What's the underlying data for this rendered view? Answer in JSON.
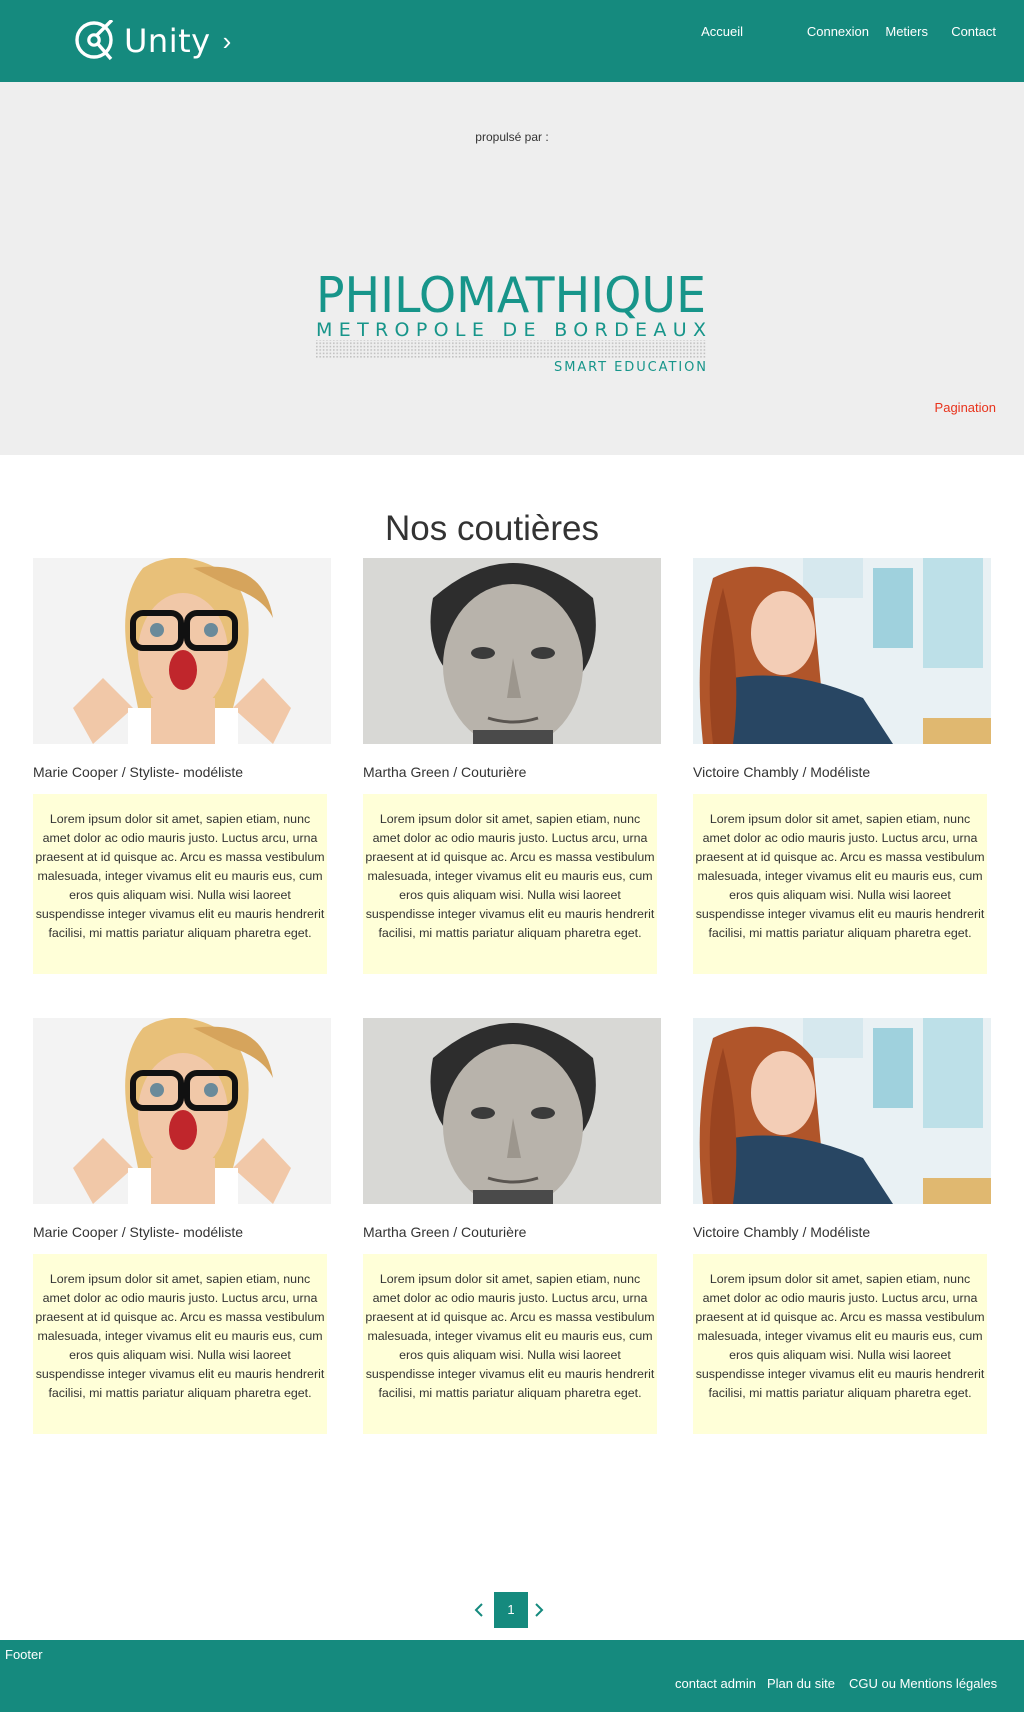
{
  "header": {
    "logo_text": "Unity",
    "nav": [
      "Accueil",
      "Connexion",
      "Metiers",
      "Contact"
    ]
  },
  "hero": {
    "powered_by": "propulsé par :",
    "brand": {
      "name": "PHILOMATHIQUE",
      "subtitle": "METROPOLE DE BORDEAUX",
      "tagline": "SMART EDUCATION"
    },
    "pagination_label": "Pagination"
  },
  "section": {
    "title": "Nos coutières"
  },
  "cards": [
    {
      "name": "Marie Cooper / Styliste- modéliste",
      "text": "Lorem ipsum dolor sit amet, sapien etiam, nunc amet dolor ac odio mauris justo. Luctus arcu, urna praesent at id quisque ac. Arcu es massa vestibulum malesuada, integer vivamus elit eu mauris eus, cum eros quis aliquam wisi. Nulla wisi laoreet suspendisse integer vivamus elit eu mauris hendrerit facilisi, mi mattis pariatur aliquam pharetra eget."
    },
    {
      "name": "Martha Green / Couturière",
      "text": "Lorem ipsum dolor sit amet, sapien etiam, nunc amet dolor ac odio mauris justo. Luctus arcu, urna praesent at id quisque ac. Arcu es massa vestibulum malesuada, integer vivamus elit eu mauris eus, cum eros quis aliquam wisi. Nulla wisi laoreet suspendisse integer vivamus elit eu mauris hendrerit facilisi, mi mattis pariatur aliquam pharetra eget."
    },
    {
      "name": "Victoire Chambly / Modéliste",
      "text": "Lorem ipsum dolor sit amet, sapien etiam, nunc amet dolor ac odio mauris justo. Luctus arcu, urna praesent at id quisque ac. Arcu es massa vestibulum malesuada, integer vivamus elit eu mauris eus, cum eros quis aliquam wisi. Nulla wisi laoreet suspendisse integer vivamus elit eu mauris hendrerit facilisi, mi mattis pariatur aliquam pharetra eget."
    },
    {
      "name": "Marie Cooper / Styliste- modéliste",
      "text": "Lorem ipsum dolor sit amet, sapien etiam, nunc amet dolor ac odio mauris justo. Luctus arcu, urna praesent at id quisque ac. Arcu es massa vestibulum malesuada, integer vivamus elit eu mauris eus, cum eros quis aliquam wisi. Nulla wisi laoreet suspendisse integer vivamus elit eu mauris hendrerit facilisi, mi mattis pariatur aliquam pharetra eget."
    },
    {
      "name": "Martha Green / Couturière",
      "text": "Lorem ipsum dolor sit amet, sapien etiam, nunc amet dolor ac odio mauris justo. Luctus arcu, urna praesent at id quisque ac. Arcu es massa vestibulum malesuada, integer vivamus elit eu mauris eus, cum eros quis aliquam wisi. Nulla wisi laoreet suspendisse integer vivamus elit eu mauris hendrerit facilisi, mi mattis pariatur aliquam pharetra eget."
    },
    {
      "name": "Victoire Chambly / Modéliste",
      "text": "Lorem ipsum dolor sit amet, sapien etiam, nunc amet dolor ac odio mauris justo. Luctus arcu, urna praesent at id quisque ac. Arcu es massa vestibulum malesuada, integer vivamus elit eu mauris eus, cum eros quis aliquam wisi. Nulla wisi laoreet suspendisse integer vivamus elit eu mauris hendrerit facilisi, mi mattis pariatur aliquam pharetra eget."
    }
  ],
  "pager": {
    "current_page": "1",
    "prev_icon": "chevron-left-icon",
    "next_icon": "chevron-right-icon"
  },
  "footer": {
    "label": "Footer",
    "links": [
      "contact admin",
      "Plan du site",
      "CGU ou Mentions légales"
    ]
  },
  "colors": {
    "brand": "#158a7e",
    "hero_bg": "#eeeeee",
    "card_text_bg": "#ffffd8",
    "pagination_label": "#e8331c"
  }
}
